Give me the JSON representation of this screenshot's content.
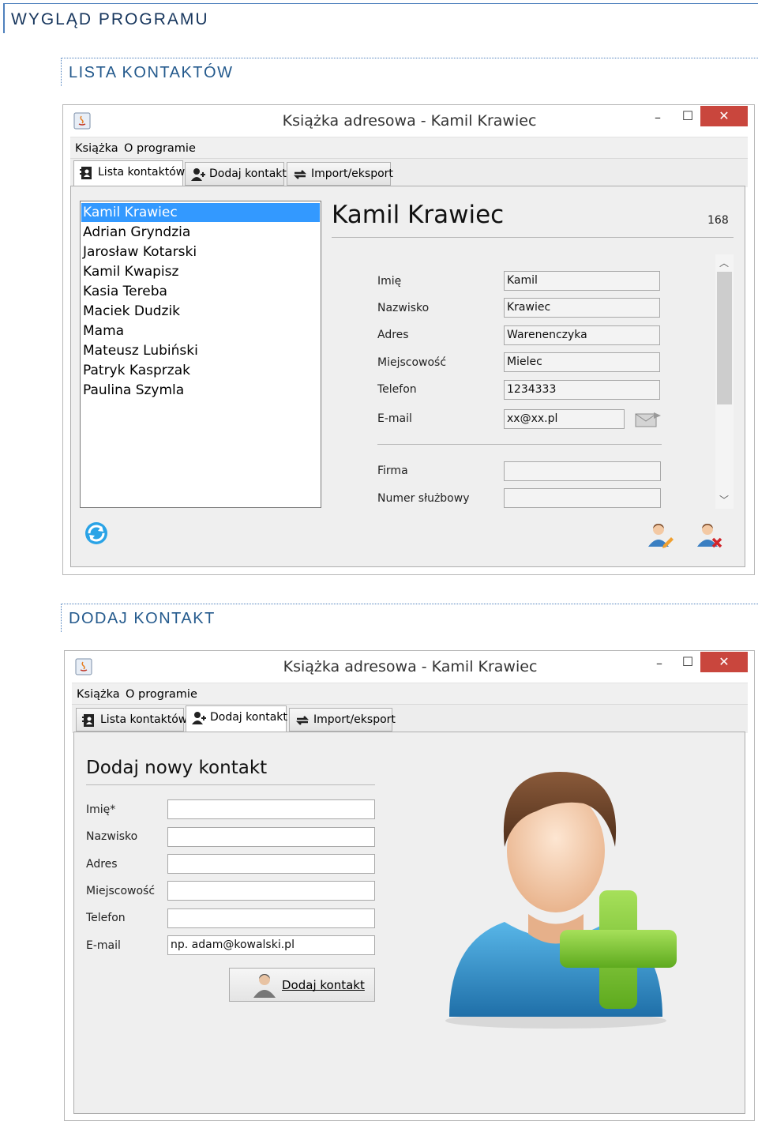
{
  "doc": {
    "heading": "WYGLĄD PROGRAMU",
    "section1": "LISTA KONTAKTÓW",
    "section2": "DODAJ KONTAKT"
  },
  "window": {
    "title": "Książka adresowa - Kamil Krawiec",
    "minimize": "–",
    "maximize": "☐",
    "close": "✕"
  },
  "menu": [
    "Książka",
    "O programie"
  ],
  "tabs": [
    "Lista kontaktów",
    "Dodaj kontakt",
    "Import/eksport"
  ],
  "list_view": {
    "contacts": [
      "Kamil Krawiec",
      "Adrian Gryndzia",
      "Jarosław Kotarski",
      "Kamil Kwapisz",
      "Kasia Tereba",
      "Maciek Dudzik",
      "Mama",
      "Mateusz Lubiński",
      "Patryk Kasprzak",
      "Paulina Szymla"
    ],
    "selected_index": 0,
    "detail_name": "Kamil Krawiec",
    "detail_id": "168",
    "fields": [
      {
        "label": "Imię",
        "value": "Kamil"
      },
      {
        "label": "Nazwisko",
        "value": "Krawiec"
      },
      {
        "label": "Adres",
        "value": "Warenenczyka"
      },
      {
        "label": "Miejscowość",
        "value": "Mielec"
      },
      {
        "label": "Telefon",
        "value": "1234333"
      },
      {
        "label": "E-mail",
        "value": "xx@xx.pl"
      }
    ],
    "extra_fields": [
      {
        "label": "Firma",
        "value": ""
      },
      {
        "label": "Numer służbowy",
        "value": ""
      }
    ]
  },
  "add_view": {
    "title": "Dodaj nowy kontakt",
    "fields": [
      {
        "label": "Imię*",
        "value": ""
      },
      {
        "label": "Nazwisko",
        "value": ""
      },
      {
        "label": "Adres",
        "value": ""
      },
      {
        "label": "Miejscowość",
        "value": ""
      },
      {
        "label": "Telefon",
        "value": ""
      },
      {
        "label": "E-mail",
        "value": "np. adam@kowalski.pl"
      }
    ],
    "submit": "Dodaj kontakt"
  },
  "colors": {
    "selection": "#3399ff",
    "close": "#c9463d",
    "heading": "#17365d",
    "plus": "#7cc232"
  }
}
